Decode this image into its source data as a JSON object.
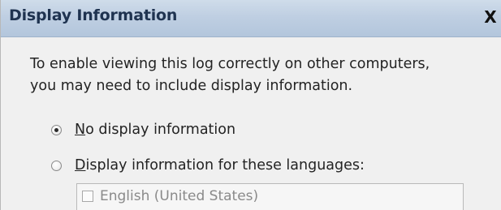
{
  "window": {
    "title": "Display Information",
    "close_glyph": "X"
  },
  "intro": {
    "line1": "To enable viewing this log correctly on other computers,",
    "line2": "you may need to include display information."
  },
  "options": [
    {
      "mnemonic": "N",
      "rest": "o display information",
      "selected": true
    },
    {
      "mnemonic": "D",
      "rest": "isplay information for these languages:",
      "selected": false
    }
  ],
  "languages": [
    {
      "label": "English (United States)",
      "checked": false,
      "enabled": false
    }
  ],
  "colors": {
    "title_bar": "#bfcfe2",
    "title_text": "#1f3350",
    "dialog_bg": "#f0f0f0",
    "disabled_text": "#8a8a8a"
  }
}
